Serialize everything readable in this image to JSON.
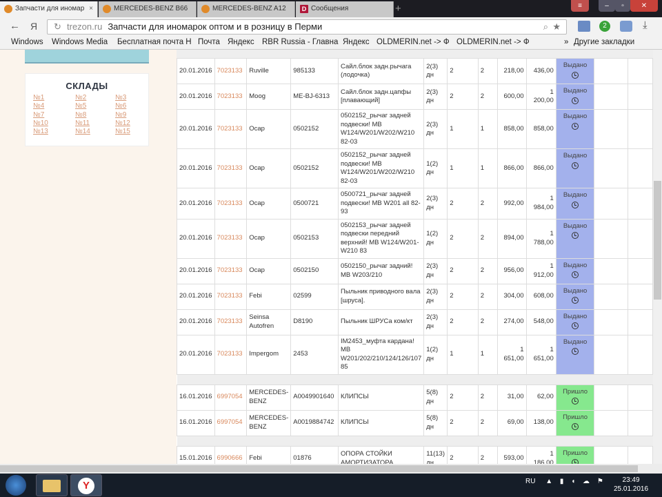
{
  "browser": {
    "tabs": [
      {
        "label": "Запчасти для иномар",
        "active": true
      },
      {
        "label": "MERCEDES-BENZ B66"
      },
      {
        "label": "MERCEDES-BENZ A12"
      },
      {
        "label": "Сообщения"
      }
    ],
    "url_host": "trezon.ru",
    "page_title": "Запчасти для иномарок оптом и в розницу в Перми",
    "badge_count": "2",
    "bookmarks": [
      "Windows",
      "Windows Media",
      "Бесплатная почта H",
      "Почта",
      "Яндекс",
      "RBR Russia - Главна",
      "Яндекс",
      "OLDMERIN.net -> Ф",
      "OLDMERIN.net -> Ф",
      "Другие закладки"
    ]
  },
  "sidebar": {
    "title": "СКЛАДЫ",
    "warehouses": [
      "№1",
      "№2",
      "№3",
      "№4",
      "№5",
      "№6",
      "№7",
      "№8",
      "№9",
      "№10",
      "№11",
      "№12",
      "№13",
      "№14",
      "№15"
    ]
  },
  "orders": {
    "groups": [
      {
        "rows": [
          {
            "date": "20.01.2016",
            "order": "7023133",
            "brand": "Ruville",
            "article": "985133",
            "desc": "Сайл.блок задн.рычага (лодочка)",
            "term": "2(3) дн",
            "qty": "2",
            "qty2": "2",
            "price": "218,00",
            "sum": "436,00",
            "status": "Выдано"
          },
          {
            "date": "20.01.2016",
            "order": "7023133",
            "brand": "Moog",
            "article": "ME-BJ-6313",
            "desc": "Сайл.блок задн.цапфы [плавающий]",
            "term": "2(3) дн",
            "qty": "2",
            "qty2": "2",
            "price": "600,00",
            "sum": "1 200,00",
            "status": "Выдано"
          },
          {
            "date": "20.01.2016",
            "order": "7023133",
            "brand": "Ocap",
            "article": "0502152",
            "desc": "0502152_рычаг задней подвески! MB W124/W201/W202/W210 82-03",
            "term": "2(3) дн",
            "qty": "1",
            "qty2": "1",
            "price": "858,00",
            "sum": "858,00",
            "status": "Выдано"
          },
          {
            "date": "20.01.2016",
            "order": "7023133",
            "brand": "Ocap",
            "article": "0502152",
            "desc": "0502152_рычаг задней подвески! MB W124/W201/W202/W210 82-03",
            "term": "1(2) дн",
            "qty": "1",
            "qty2": "1",
            "price": "866,00",
            "sum": "866,00",
            "status": "Выдано"
          },
          {
            "date": "20.01.2016",
            "order": "7023133",
            "brand": "Ocap",
            "article": "0500721",
            "desc": "0500721_рычаг задней подвески! MB W201 all 82-93",
            "term": "2(3) дн",
            "qty": "2",
            "qty2": "2",
            "price": "992,00",
            "sum": "1 984,00",
            "status": "Выдано"
          },
          {
            "date": "20.01.2016",
            "order": "7023133",
            "brand": "Ocap",
            "article": "0502153",
            "desc": "0502153_рычаг задней подвески передний верхний! MB W124/W201-W210 83",
            "term": "1(2) дн",
            "qty": "2",
            "qty2": "2",
            "price": "894,00",
            "sum": "1 788,00",
            "status": "Выдано"
          },
          {
            "date": "20.01.2016",
            "order": "7023133",
            "brand": "Ocap",
            "article": "0502150",
            "desc": "0502150_рычаг задний! MB W203/210",
            "term": "2(3) дн",
            "qty": "2",
            "qty2": "2",
            "price": "956,00",
            "sum": "1 912,00",
            "status": "Выдано"
          },
          {
            "date": "20.01.2016",
            "order": "7023133",
            "brand": "Febi",
            "article": "02599",
            "desc": "Пыльник приводного вала [шруса].",
            "term": "2(3) дн",
            "qty": "2",
            "qty2": "2",
            "price": "304,00",
            "sum": "608,00",
            "status": "Выдано"
          },
          {
            "date": "20.01.2016",
            "order": "7023133",
            "brand": "Seinsa Autofren",
            "article": "D8190",
            "desc": "Пыльник ШРУСа ком/кт",
            "term": "2(3) дн",
            "qty": "2",
            "qty2": "2",
            "price": "274,00",
            "sum": "548,00",
            "status": "Выдано"
          },
          {
            "date": "20.01.2016",
            "order": "7023133",
            "brand": "Impergom",
            "article": "2453",
            "desc": "IM2453_муфта кардана! MB W201/202/210/124/126/107 85",
            "term": "1(2) дн",
            "qty": "1",
            "qty2": "1",
            "price": "1 651,00",
            "sum": "1 651,00",
            "status": "Выдано"
          }
        ]
      },
      {
        "rows": [
          {
            "date": "16.01.2016",
            "order": "6997054",
            "brand": "MERCEDES-BENZ",
            "article": "A0049901640",
            "desc": "КЛИПСЫ",
            "term": "5(8) дн",
            "qty": "2",
            "qty2": "2",
            "price": "31,00",
            "sum": "62,00",
            "status": "Пришло"
          },
          {
            "date": "16.01.2016",
            "order": "6997054",
            "brand": "MERCEDES-BENZ",
            "article": "A0019884742",
            "desc": "КЛИПСЫ",
            "term": "5(8) дн",
            "qty": "2",
            "qty2": "2",
            "price": "69,00",
            "sum": "138,00",
            "status": "Пришло"
          }
        ]
      },
      {
        "rows": [
          {
            "date": "15.01.2016",
            "order": "6990666",
            "brand": "Febi",
            "article": "01876",
            "desc": "ОПОРА СТОЙКИ АМОРТИЗАТОРА",
            "term": "11(13) дн",
            "qty": "2",
            "qty2": "2",
            "price": "593,00",
            "sum": "1 186,00",
            "status": "Пришло"
          }
        ]
      }
    ]
  },
  "taskbar": {
    "lang": "RU",
    "time": "23:49",
    "date": "25.01.2016"
  }
}
